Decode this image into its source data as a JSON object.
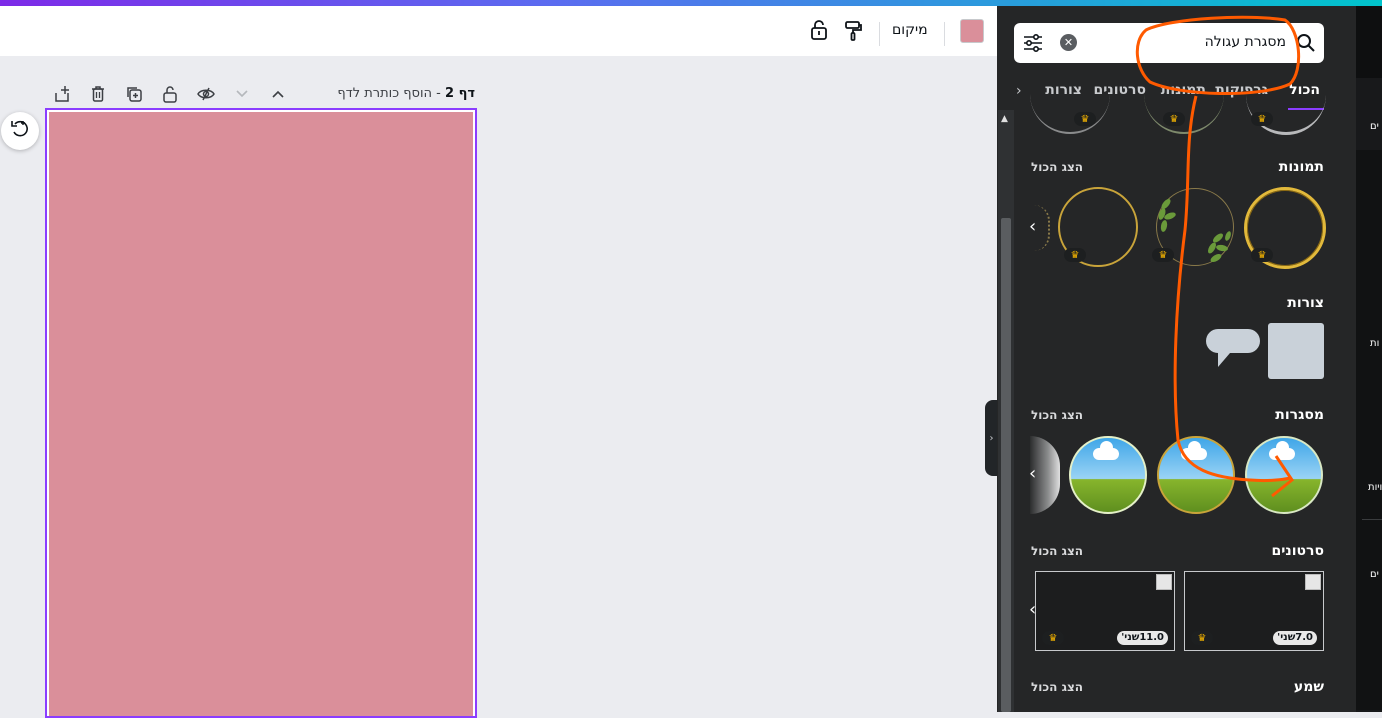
{
  "toolbar": {
    "position_label": "מיקום",
    "color_swatch": "#da8f9a",
    "icons": [
      "paint-roller-icon",
      "lock-icon"
    ]
  },
  "page_header": {
    "page_number": "דף 2",
    "separator": "-",
    "add_title_placeholder": "הוסף כותרת לדף",
    "icons": [
      "chevron-up-icon",
      "chevron-down-icon",
      "hide-icon",
      "lock-icon",
      "duplicate-icon",
      "trash-icon",
      "add-page-icon"
    ]
  },
  "page": {
    "background_color": "#da8f9a",
    "border_color": "#8b3dff"
  },
  "search": {
    "query": "מסגרת עגולה",
    "icons": [
      "search-icon",
      "clear-icon",
      "filter-icon"
    ]
  },
  "tabs": [
    {
      "label": "הכול",
      "active": true
    },
    {
      "label": "גרפיקות",
      "active": false
    },
    {
      "label": "תמונות",
      "active": false
    },
    {
      "label": "סרטונים",
      "active": false
    },
    {
      "label": "צורות",
      "active": false
    }
  ],
  "sections": {
    "photos": {
      "title": "תמונות",
      "see_all": "הצג הכול"
    },
    "shapes": {
      "title": "צורות"
    },
    "frames": {
      "title": "מסגרות",
      "see_all": "הצג הכול"
    },
    "videos": {
      "title": "סרטונים",
      "see_all": "הצג הכול",
      "items": [
        {
          "duration": "7.0שני'"
        },
        {
          "duration": "11.0שני'"
        }
      ]
    },
    "audio": {
      "title": "שמע",
      "see_all": "הצג הכול"
    }
  },
  "right_sidebar": {
    "labels": [
      "ים",
      "ות",
      "ויות",
      "ים"
    ]
  },
  "colors": {
    "accent": "#8b3dff",
    "panel_bg": "#252627",
    "annotation": "#ff5a00"
  }
}
